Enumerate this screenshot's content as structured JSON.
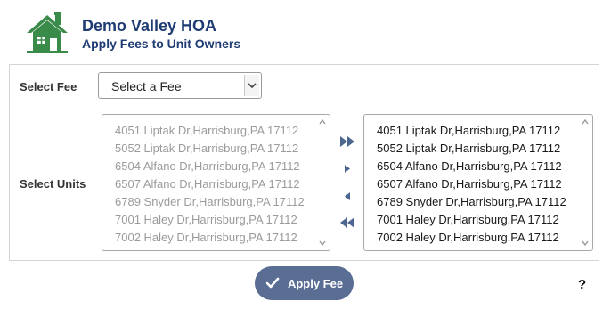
{
  "header": {
    "org_name": "Demo Valley HOA",
    "subtitle": "Apply Fees to Unit Owners",
    "logo_icon": "house-icon",
    "logo_color": "#3a8a4a"
  },
  "form": {
    "fee_label": "Select Fee",
    "fee_select_value": "Select a Fee",
    "units_label": "Select Units"
  },
  "available_units": [
    "4051 Liptak Dr,Harrisburg,PA 17112",
    "5052 Liptak Dr,Harrisburg,PA 17112",
    "6504 Alfano Dr,Harrisburg,PA 17112",
    "6507 Alfano Dr,Harrisburg,PA 17112",
    "6789 Snyder Dr,Harrisburg,PA 17112",
    "7001 Haley Dr,Harrisburg,PA 17112",
    "7002 Haley Dr,Harrisburg,PA 17112"
  ],
  "selected_units": [
    "4051 Liptak Dr,Harrisburg,PA 17112",
    "5052 Liptak Dr,Harrisburg,PA 17112",
    "6504 Alfano Dr,Harrisburg,PA 17112",
    "6507 Alfano Dr,Harrisburg,PA 17112",
    "6789 Snyder Dr,Harrisburg,PA 17112",
    "7001 Haley Dr,Harrisburg,PA 17112",
    "7002 Haley Dr,Harrisburg,PA 17112"
  ],
  "move_buttons": {
    "all_right_icon": "double-chevron-right-icon",
    "right_icon": "triangle-right-icon",
    "left_icon": "triangle-left-icon",
    "all_left_icon": "double-chevron-left-icon",
    "color": "#4d6691"
  },
  "actions": {
    "apply_label": "Apply Fee",
    "apply_icon": "checkmark-icon",
    "apply_color": "#5a6d93",
    "help_label": "?"
  }
}
